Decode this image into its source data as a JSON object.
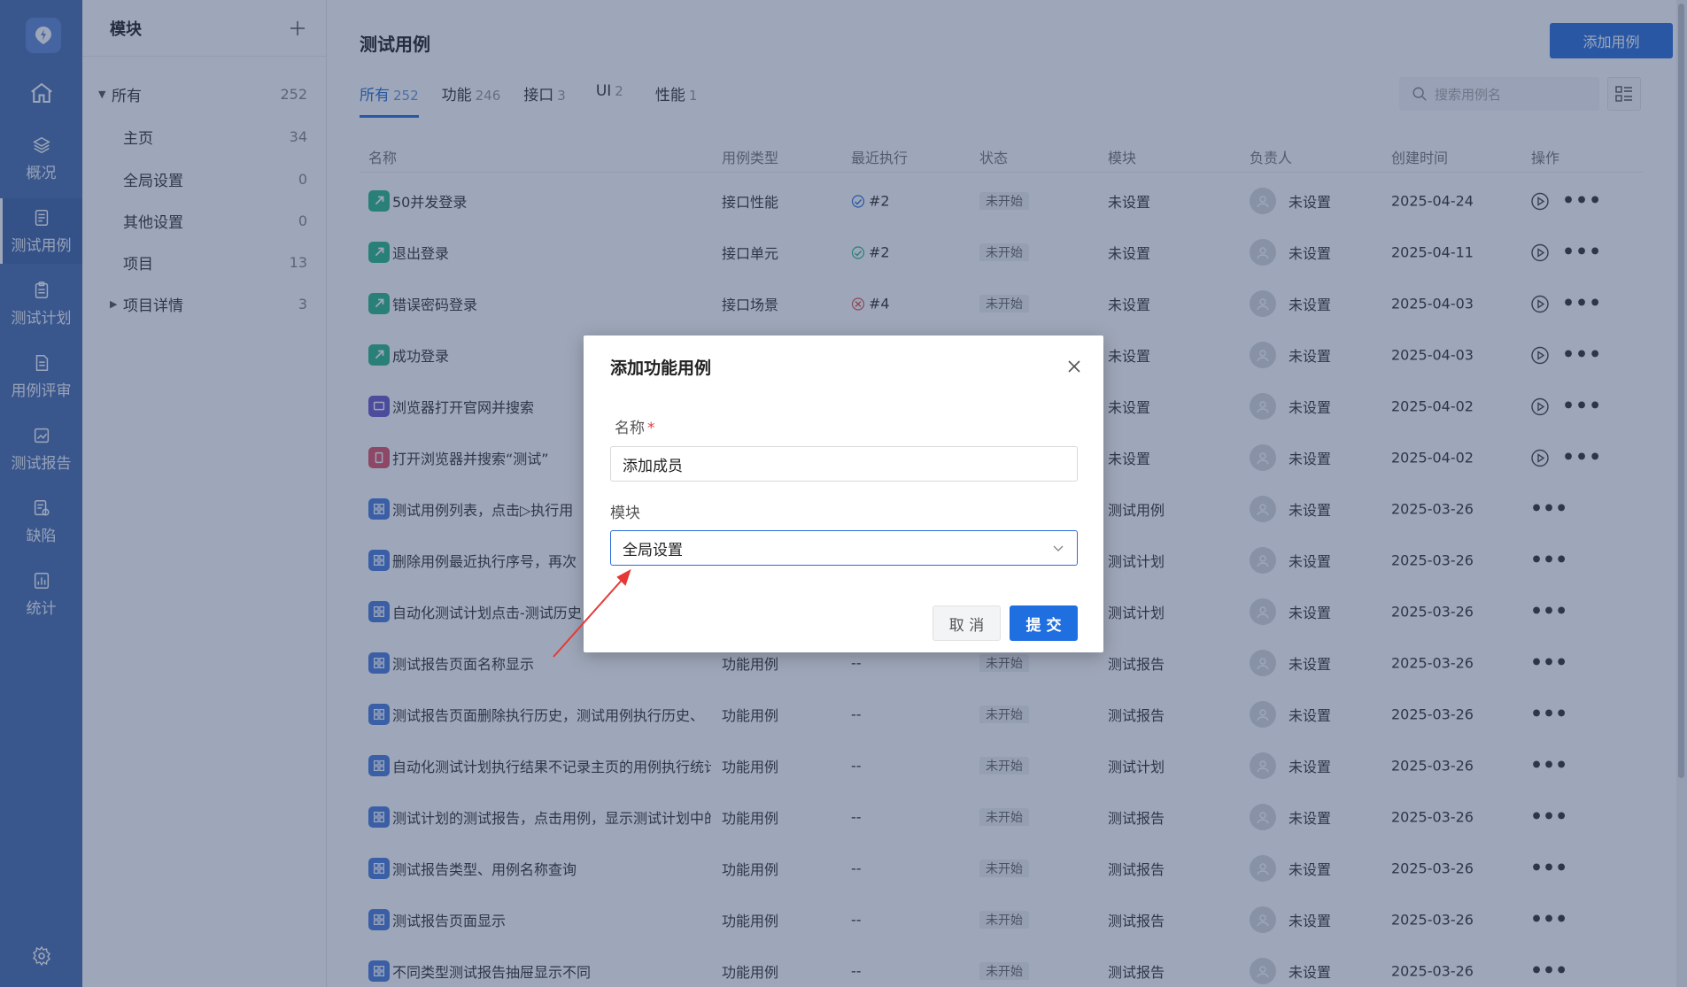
{
  "nav": {
    "items": [
      {
        "label": "",
        "icon": "home-icon"
      },
      {
        "label": "概况",
        "icon": "layers-icon"
      },
      {
        "label": "测试用例",
        "icon": "testcase-icon"
      },
      {
        "label": "测试计划",
        "icon": "clipboard-icon"
      },
      {
        "label": "用例评审",
        "icon": "review-icon"
      },
      {
        "label": "测试报告",
        "icon": "report-icon"
      },
      {
        "label": "缺陷",
        "icon": "bug-icon"
      },
      {
        "label": "统计",
        "icon": "chart-icon"
      }
    ],
    "settings_icon": "gear-icon"
  },
  "modules": {
    "title": "模块",
    "items": [
      {
        "label": "所有",
        "count": "252"
      },
      {
        "label": "主页",
        "count": "34"
      },
      {
        "label": "全局设置",
        "count": "0"
      },
      {
        "label": "其他设置",
        "count": "0"
      },
      {
        "label": "项目",
        "count": "13"
      },
      {
        "label": "项目详情",
        "count": "3"
      }
    ]
  },
  "main": {
    "title": "测试用例",
    "add_button": "添加用例",
    "tabs": [
      {
        "label": "所有",
        "count": "252"
      },
      {
        "label": "功能",
        "count": "246"
      },
      {
        "label": "接口",
        "count": "3"
      },
      {
        "label": "UI",
        "count": "2"
      },
      {
        "label": "性能",
        "count": "1"
      }
    ],
    "search_placeholder": "搜索用例名",
    "columns": [
      "名称",
      "用例类型",
      "最近执行",
      "状态",
      "模块",
      "负责人",
      "创建时间",
      "操作"
    ],
    "rows": [
      {
        "name": "50并发登录",
        "type": "接口性能",
        "exec": "#2",
        "status": "未开始",
        "module": "未设置",
        "owner": "未设置",
        "date": "2025-04-24"
      },
      {
        "name": "退出登录",
        "type": "接口单元",
        "exec": "#2",
        "status": "未开始",
        "module": "未设置",
        "owner": "未设置",
        "date": "2025-04-11"
      },
      {
        "name": "错误密码登录",
        "type": "接口场景",
        "exec": "#4",
        "status": "未开始",
        "module": "未设置",
        "owner": "未设置",
        "date": "2025-04-03"
      },
      {
        "name": "成功登录",
        "type": "",
        "exec": "",
        "status": "",
        "module": "未设置",
        "owner": "未设置",
        "date": "2025-04-03"
      },
      {
        "name": "浏览器打开官网并搜索",
        "type": "",
        "exec": "",
        "status": "",
        "module": "未设置",
        "owner": "未设置",
        "date": "2025-04-02"
      },
      {
        "name": "打开浏览器并搜索“测试”",
        "type": "",
        "exec": "",
        "status": "",
        "module": "未设置",
        "owner": "未设置",
        "date": "2025-04-02"
      },
      {
        "name": "测试用例列表，点击▷执行用",
        "type": "",
        "exec": "",
        "status": "",
        "module": "测试用例",
        "owner": "未设置",
        "date": "2025-03-26"
      },
      {
        "name": "删除用例最近执行序号，再次",
        "type": "",
        "exec": "",
        "status": "",
        "module": "测试计划",
        "owner": "未设置",
        "date": "2025-03-26"
      },
      {
        "name": "自动化测试计划点击-测试历史",
        "type": "",
        "exec": "",
        "status": "",
        "module": "测试计划",
        "owner": "未设置",
        "date": "2025-03-26"
      },
      {
        "name": "测试报告页面名称显示",
        "type": "功能用例",
        "exec": "--",
        "status": "未开始",
        "module": "测试报告",
        "owner": "未设置",
        "date": "2025-03-26"
      },
      {
        "name": "测试报告页面删除执行历史，测试用例执行历史、",
        "type": "功能用例",
        "exec": "--",
        "status": "未开始",
        "module": "测试报告",
        "owner": "未设置",
        "date": "2025-03-26"
      },
      {
        "name": "自动化测试计划执行结果不记录主页的用例执行统计",
        "type": "功能用例",
        "exec": "--",
        "status": "未开始",
        "module": "测试计划",
        "owner": "未设置",
        "date": "2025-03-26"
      },
      {
        "name": "测试计划的测试报告，点击用例，显示测试计划中的",
        "type": "功能用例",
        "exec": "--",
        "status": "未开始",
        "module": "测试报告",
        "owner": "未设置",
        "date": "2025-03-26"
      },
      {
        "name": "测试报告类型、用例名称查询",
        "type": "功能用例",
        "exec": "--",
        "status": "未开始",
        "module": "测试报告",
        "owner": "未设置",
        "date": "2025-03-26"
      },
      {
        "name": "测试报告页面显示",
        "type": "功能用例",
        "exec": "--",
        "status": "未开始",
        "module": "测试报告",
        "owner": "未设置",
        "date": "2025-03-26"
      },
      {
        "name": "不同类型测试报告抽屉显示不同",
        "type": "功能用例",
        "exec": "--",
        "status": "未开始",
        "module": "测试报告",
        "owner": "未设置",
        "date": "2025-03-26"
      }
    ]
  },
  "modal": {
    "title": "添加功能用例",
    "name_label": "名称",
    "required_mark": "*",
    "name_value": "添加成员",
    "module_label": "模块",
    "module_value": "全局设置",
    "cancel": "取 消",
    "submit": "提 交"
  },
  "colors": {
    "accent": "#2a6dd9",
    "nav_bg": "#4a6eb0",
    "annotation_arrow": "#e53935"
  }
}
